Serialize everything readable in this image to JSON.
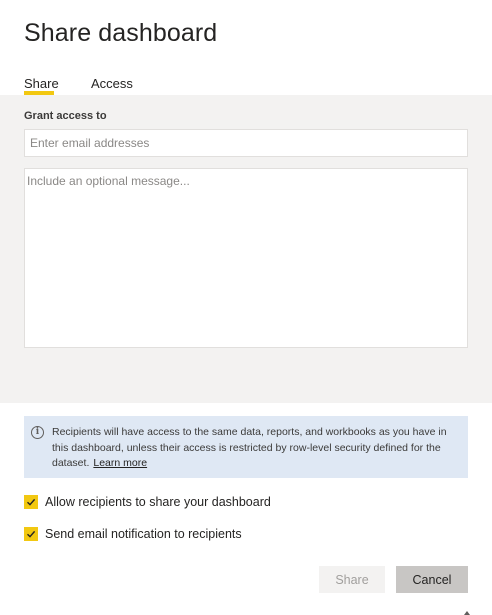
{
  "dialog": {
    "title": "Share dashboard"
  },
  "tabs": [
    {
      "label": "Share",
      "active": true
    },
    {
      "label": "Access",
      "active": false
    }
  ],
  "form": {
    "grant_label": "Grant access to",
    "email_placeholder": "Enter email addresses",
    "message_placeholder": "Include an optional message..."
  },
  "info": {
    "text": "Recipients will have access to the same data, reports, and workbooks as you have in this dashboard, unless their access is restricted by row-level security defined for the dataset.",
    "link_label": "Learn more",
    "icon": "info-icon"
  },
  "options": [
    {
      "label": "Allow recipients to share your dashboard",
      "checked": true
    },
    {
      "label": "Send email notification to recipients",
      "checked": true
    }
  ],
  "buttons": {
    "share_label": "Share",
    "share_disabled": true,
    "cancel_label": "Cancel"
  },
  "colors": {
    "accent": "#f2c811",
    "panel_bg": "#f3f2f1",
    "info_bg": "#dfe8f4"
  }
}
